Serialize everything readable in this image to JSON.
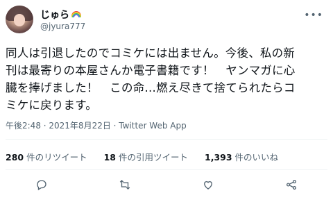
{
  "user": {
    "display_name": "じゅら",
    "handle": "@jyura777",
    "badge_icon": "rainbow-emoji"
  },
  "tweet": {
    "text": "同人は引退したのでコミケには出ません。今後、私の新\n刊は最寄りの本屋さんか電子書籍です！　ヤンマガに心\n臓を捧げました！　この命…燃え尽きて捨てられたらコ\nミケに戻ります。",
    "timestamp": "午後2:48 · 2021年8月22日 · Twitter Web App"
  },
  "stats": {
    "retweets_count": "280",
    "retweets_label": "件のリツイート",
    "quotes_count": "18",
    "quotes_label": "件の引用ツイート",
    "likes_count": "1,393",
    "likes_label": "件のいいね"
  },
  "actions": [
    "reply-icon",
    "retweet-icon",
    "like-icon",
    "share-icon"
  ],
  "colors": {
    "text": "#0f1419",
    "secondary": "#536471",
    "divider": "#eff3f4"
  }
}
